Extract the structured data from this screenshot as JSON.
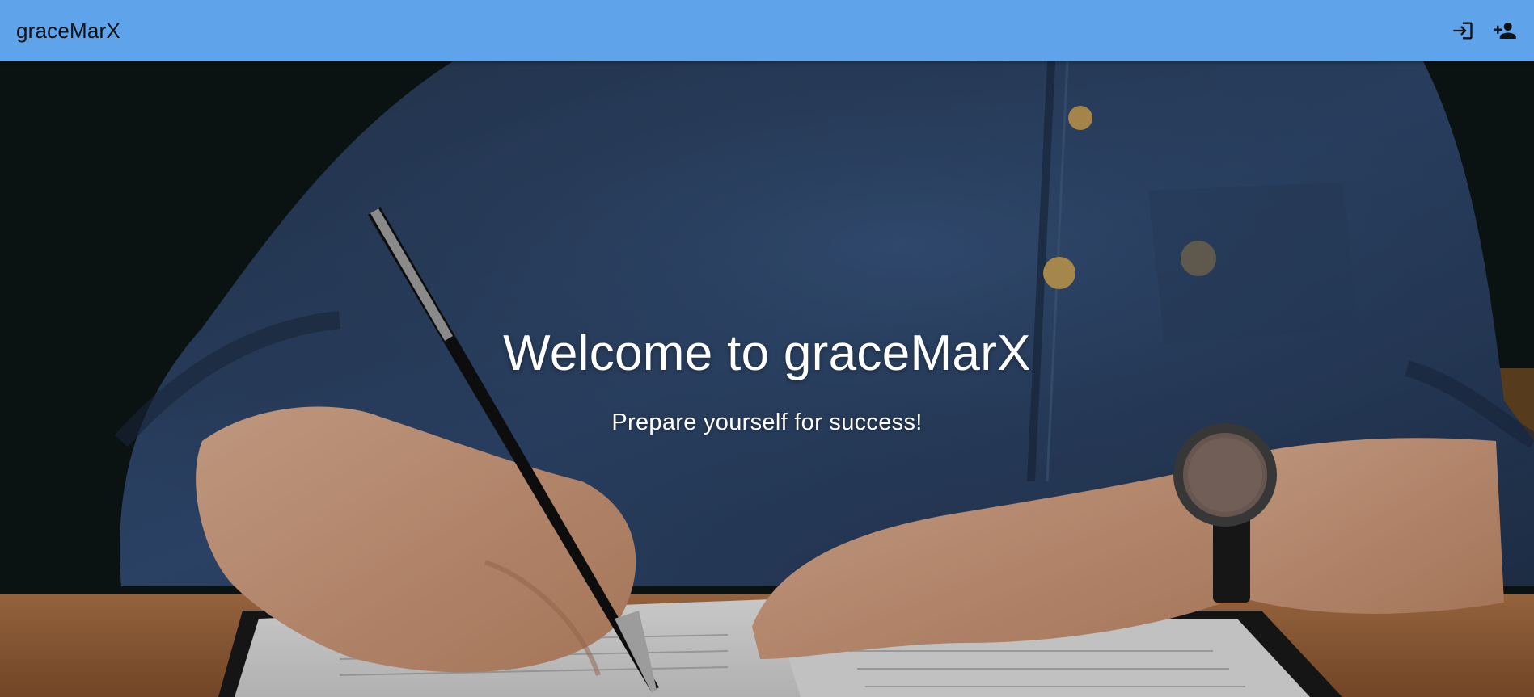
{
  "app": {
    "brand": "graceMarX"
  },
  "toolbar": {
    "icons": [
      "login-icon",
      "person-add-icon"
    ]
  },
  "hero": {
    "title": "Welcome to graceMarX",
    "subtitle": "Prepare yourself for success!",
    "image": "person-writing-with-pen-background"
  },
  "colors": {
    "topbar": "#5fa3ea",
    "text_on_hero": "#ffffff"
  }
}
